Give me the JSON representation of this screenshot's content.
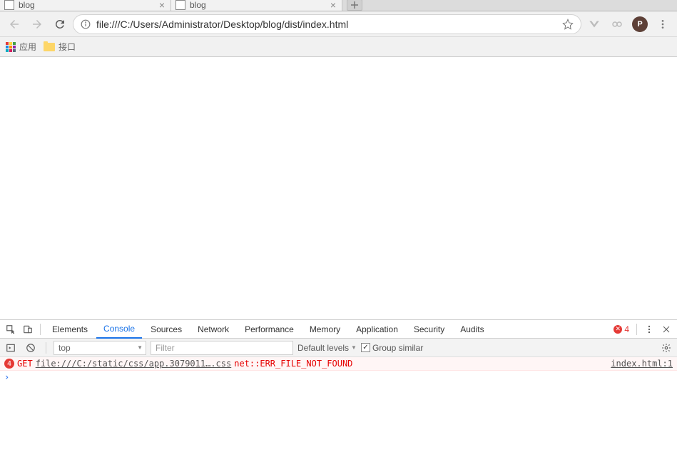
{
  "tabs": [
    {
      "title": "blog"
    },
    {
      "title": "blog"
    }
  ],
  "toolbar": {
    "url": "file:///C:/Users/Administrator/Desktop/blog/dist/index.html"
  },
  "bookmarks": {
    "apps_label": "应用",
    "items": [
      {
        "label": "接口"
      }
    ]
  },
  "devtools": {
    "tabs": {
      "elements": "Elements",
      "console": "Console",
      "sources": "Sources",
      "network": "Network",
      "performance": "Performance",
      "memory": "Memory",
      "application": "Application",
      "security": "Security",
      "audits": "Audits"
    },
    "error_count": "4",
    "console_toolbar": {
      "context": "top",
      "filter_placeholder": "Filter",
      "default_levels": "Default levels",
      "group_similar": "Group similar"
    },
    "console_error": {
      "badge": "4",
      "method": "GET",
      "url": "file:///C:/static/css/app.3079011….css",
      "code": "net::ERR_FILE_NOT_FOUND",
      "source": "index.html:1"
    }
  },
  "avatar_letter": "P"
}
